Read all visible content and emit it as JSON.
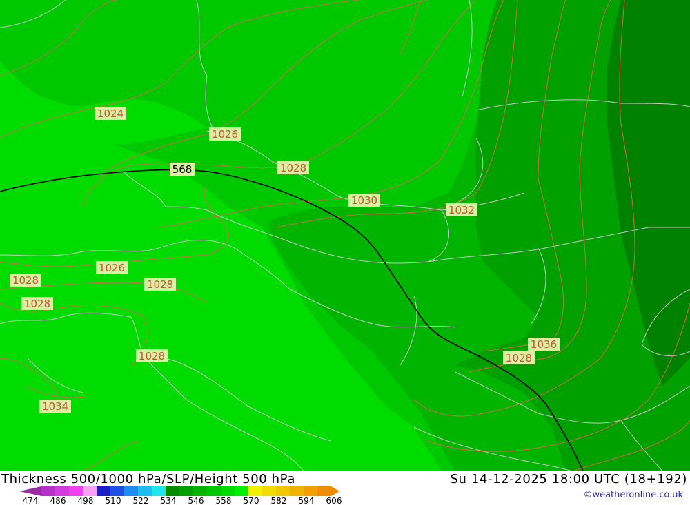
{
  "header": {
    "title": "Thickness 500/1000 hPa/SLP/Height 500 hPa",
    "datetime": "Su 14-12-2025 18:00 UTC (18+192)",
    "credit": "©weatheronline.co.uk"
  },
  "map": {
    "height_contour_label": "568",
    "pressure_labels": [
      "1024",
      "1026",
      "1028",
      "1030",
      "1032",
      "1026",
      "1028",
      "1028",
      "1028",
      "1028",
      "1034",
      "1036",
      "1028"
    ],
    "fill_colors": {
      "light": "#00dc00",
      "mid": "#00c800",
      "darker": "#00b400",
      "dark": "#00a000",
      "darkest": "#008200"
    },
    "isobar_color": "#d26a50",
    "border_color": "#c8c8c8",
    "height_contour_color": "#000000"
  },
  "scale": {
    "ticks": [
      "474",
      "486",
      "498",
      "510",
      "522",
      "534",
      "546",
      "558",
      "570",
      "582",
      "594",
      "606"
    ],
    "colors": [
      "#9a2aa6",
      "#b432c8",
      "#d23cdc",
      "#f040f0",
      "#f8a0f8",
      "#1e1ec8",
      "#1e50e6",
      "#1e8cf0",
      "#1ebef0",
      "#20e6f0",
      "#008c00",
      "#00a000",
      "#00b400",
      "#00c800",
      "#00dc00",
      "#00f000",
      "#f0f000",
      "#f0dc00",
      "#f0c800",
      "#f0b400",
      "#f0a000",
      "#f08c00"
    ]
  }
}
